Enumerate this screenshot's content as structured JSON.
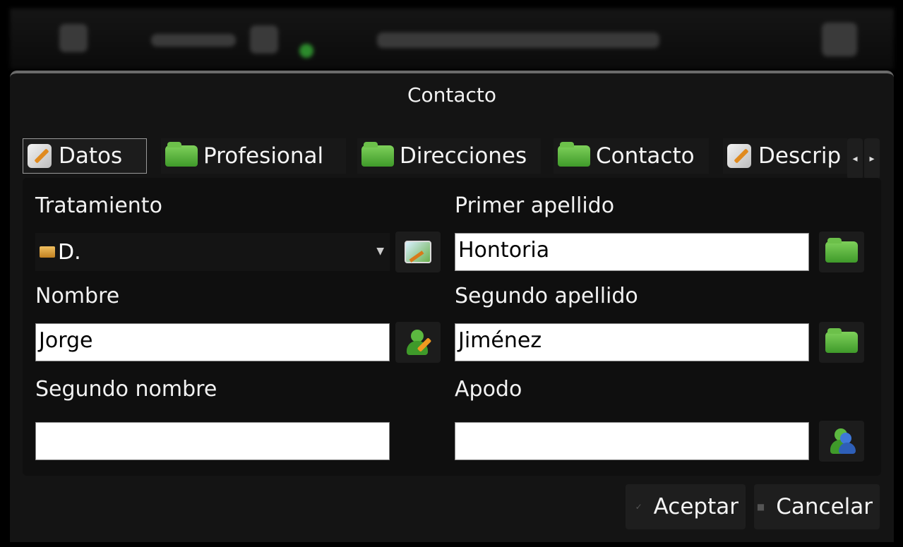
{
  "dialog": {
    "title": "Contacto"
  },
  "tabs": [
    {
      "label": "Datos",
      "icon": "pencil-edit-icon",
      "active": true
    },
    {
      "label": "Profesional",
      "icon": "folder-icon"
    },
    {
      "label": "Direcciones",
      "icon": "folder-icon"
    },
    {
      "label": "Contacto",
      "icon": "folder-icon"
    },
    {
      "label": "Descrip",
      "icon": "pencil-edit-icon"
    }
  ],
  "tab_scroll": {
    "left": "◂",
    "right": "▸"
  },
  "form": {
    "tratamiento": {
      "label": "Tratamiento",
      "value": "D."
    },
    "primer_apellido": {
      "label": "Primer apellido",
      "value": "Hontoria"
    },
    "nombre": {
      "label": "Nombre",
      "value": "Jorge"
    },
    "segundo_apellido": {
      "label": "Segundo apellido",
      "value": "Jiménez"
    },
    "segundo_nombre": {
      "label": "Segundo nombre",
      "value": ""
    },
    "apodo": {
      "label": "Apodo",
      "value": ""
    }
  },
  "buttons": {
    "accept": "Aceptar",
    "cancel": "Cancelar"
  },
  "colors": {
    "background": "#141414",
    "accent_green": "#3f9a2a"
  }
}
